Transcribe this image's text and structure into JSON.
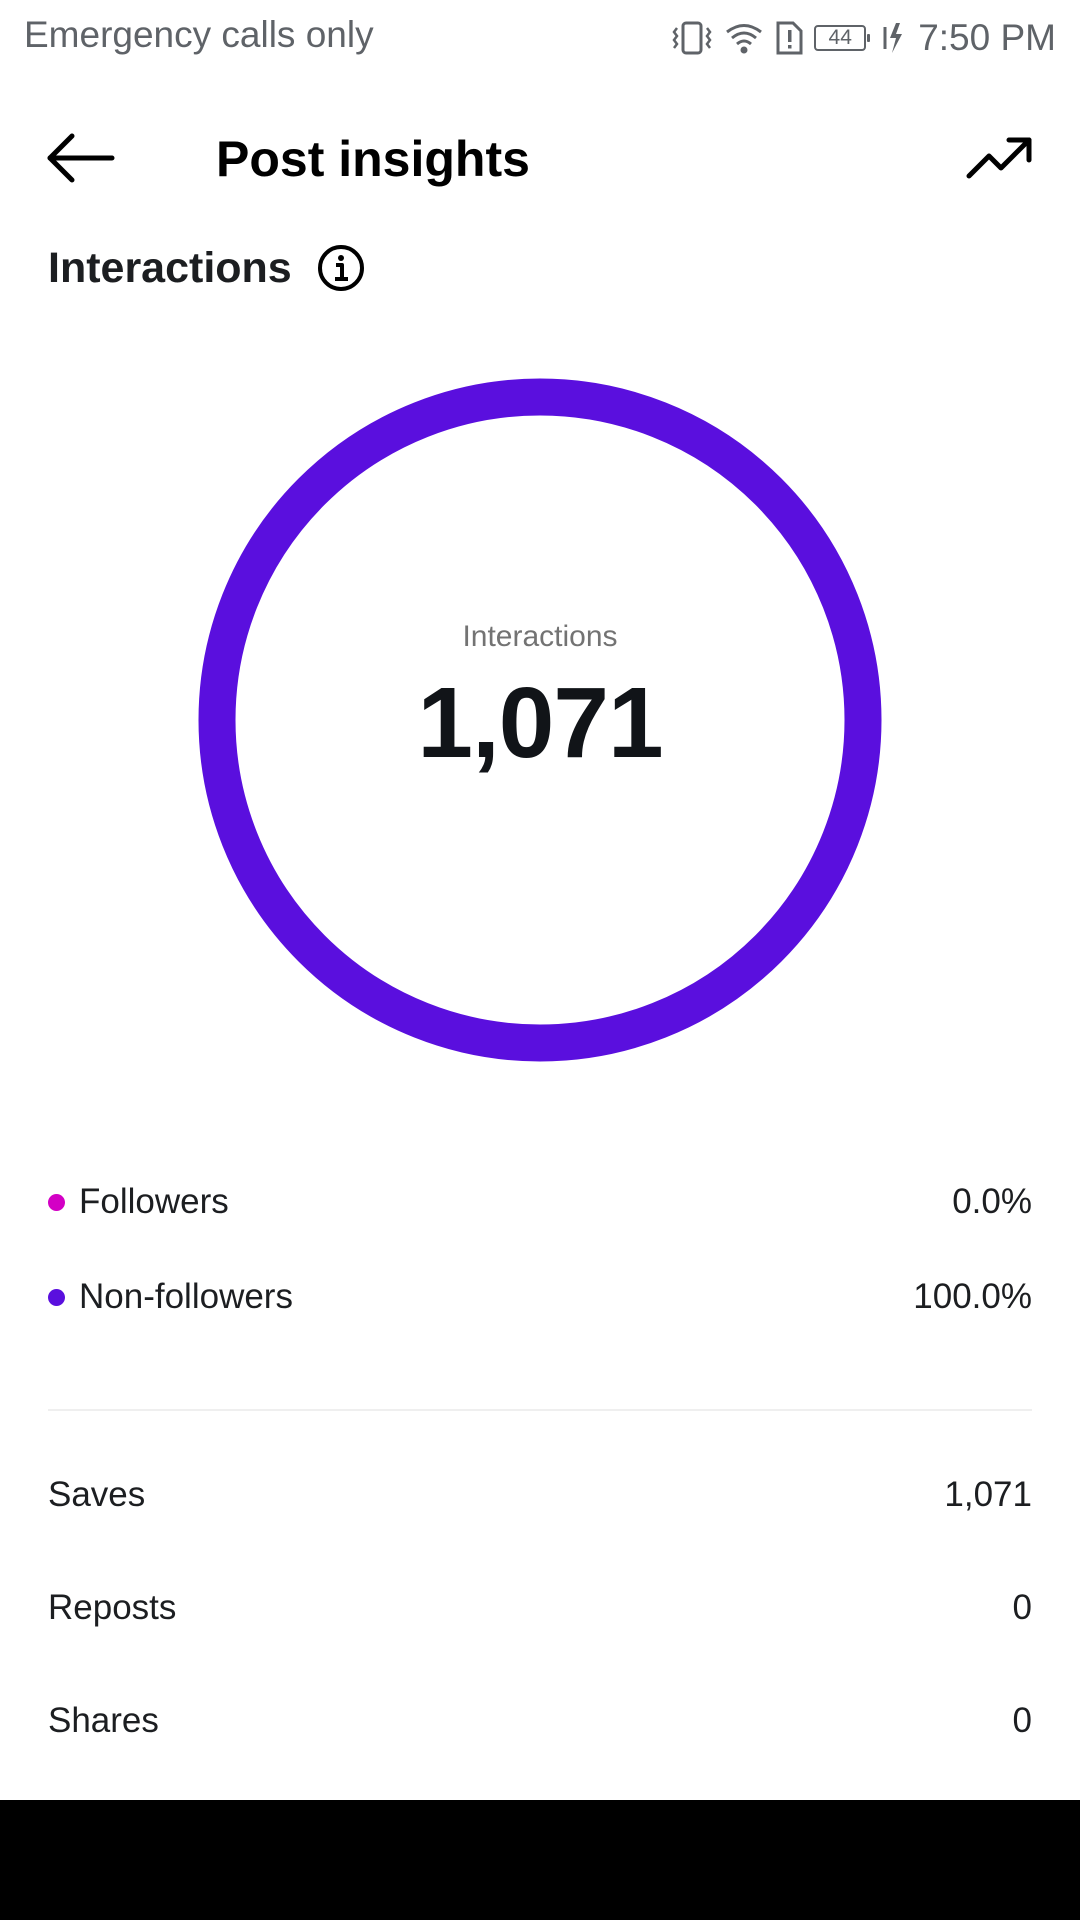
{
  "status_bar": {
    "carrier_text": "Emergency calls only",
    "battery_level": "44",
    "time": "7:50 PM",
    "icons": [
      "vibrate-icon",
      "wifi-icon",
      "sim-alert-icon",
      "battery-icon",
      "charging-icon"
    ]
  },
  "header": {
    "title": "Post insights",
    "back_icon": "back-arrow-icon",
    "trend_icon": "trending-up-icon"
  },
  "section": {
    "title": "Interactions",
    "info_icon": "info-icon"
  },
  "donut": {
    "label": "Interactions",
    "value": "1,071",
    "segments": [
      {
        "name": "Followers",
        "percent": 0.0,
        "color": "#d300c5"
      },
      {
        "name": "Non-followers",
        "percent": 100.0,
        "color": "#5a0fde"
      }
    ]
  },
  "legend": [
    {
      "label": "Followers",
      "value": "0.0%",
      "color": "#d300c5"
    },
    {
      "label": "Non-followers",
      "value": "100.0%",
      "color": "#5a0fde"
    }
  ],
  "metrics": [
    {
      "label": "Saves",
      "value": "1,071"
    },
    {
      "label": "Reposts",
      "value": "0"
    },
    {
      "label": "Shares",
      "value": "0"
    }
  ]
}
